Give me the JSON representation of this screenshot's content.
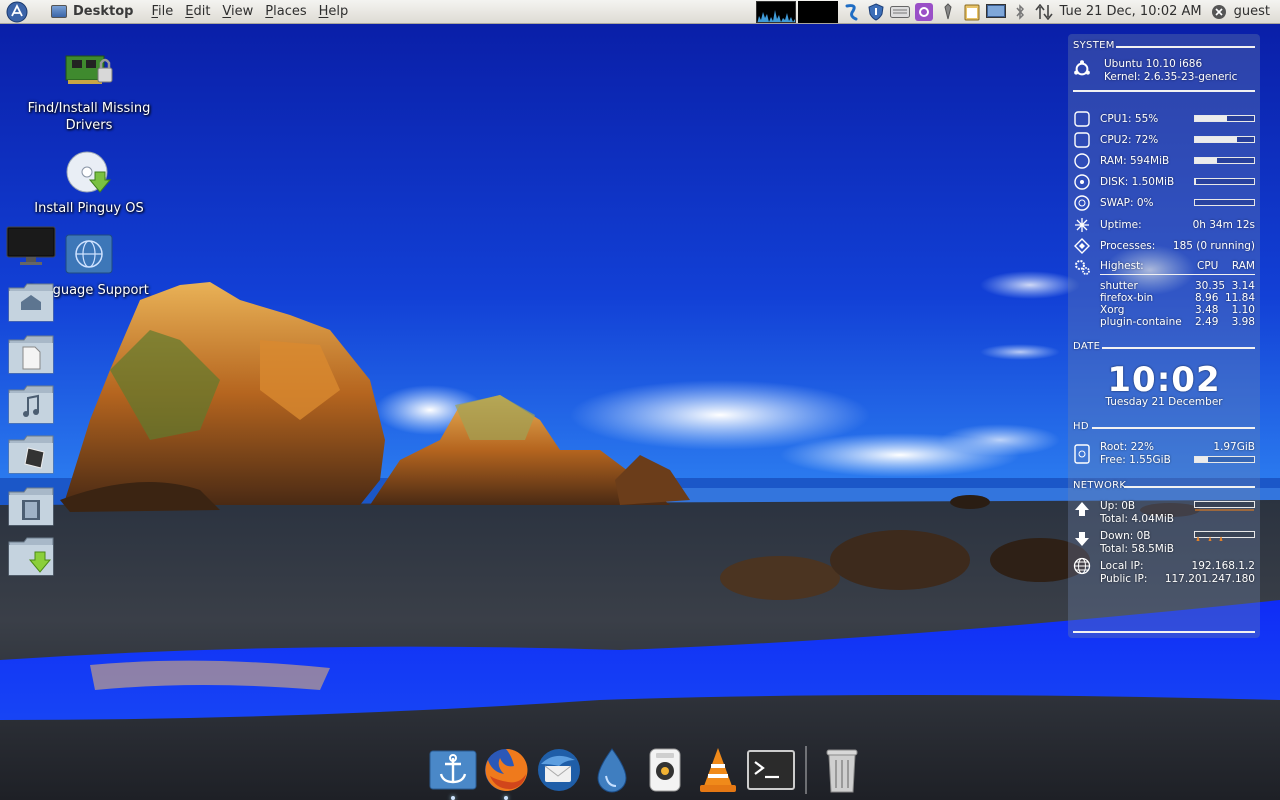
{
  "top_panel": {
    "window_title": "Desktop",
    "menus": [
      "File",
      "Edit",
      "View",
      "Places",
      "Help"
    ],
    "clock": "Tue 21 Dec, 10:02 AM",
    "user": "guest",
    "tray_icons": [
      "network-monitor-icon",
      "cpu-monitor-icon",
      "dropbox-icon",
      "shield-icon",
      "keyboard-icon",
      "settings-icon",
      "pen-icon",
      "clipboard-icon",
      "display-icon",
      "bluetooth-icon",
      "network-arrows-icon"
    ]
  },
  "desktop_icons": [
    {
      "label": "Find/Install Missing Drivers",
      "icon": "driver-card-icon"
    },
    {
      "label": "Install Pinguy OS",
      "icon": "install-disc-icon"
    },
    {
      "label": "Language Support",
      "icon": "language-globe-icon"
    }
  ],
  "left_dock": [
    "monitor-icon",
    "home-folder-icon",
    "documents-folder-icon",
    "music-folder-icon",
    "pictures-folder-icon",
    "videos-folder-icon",
    "downloads-folder-icon"
  ],
  "conky": {
    "system": {
      "heading": "SYSTEM",
      "os": "Ubuntu 10.10 i686",
      "kernel": "Kernel: 2.6.35-23-generic",
      "cpu1": "CPU1: 55%",
      "cpu1_level": 0.55,
      "cpu2": "CPU2: 72%",
      "cpu2_level": 0.72,
      "ram": "RAM: 594MiB",
      "ram_level": 0.38,
      "disk": "DISK: 1.50MiB",
      "disk_level": 0.02,
      "swap": "SWAP: 0%",
      "swap_level": 0,
      "uptime_label": "Uptime:",
      "uptime_value": "0h 34m 12s",
      "processes_label": "Processes:",
      "processes_value": "185 (0 running)",
      "highest_label": "Highest:",
      "col_cpu": "CPU",
      "col_ram": "RAM",
      "top_procs": [
        {
          "name": "shutter",
          "cpu": "30.35",
          "ram": "3.14"
        },
        {
          "name": "firefox-bin",
          "cpu": "8.96",
          "ram": "11.84"
        },
        {
          "name": "Xorg",
          "cpu": "3.48",
          "ram": "1.10"
        },
        {
          "name": "plugin-containe",
          "cpu": "2.49",
          "ram": "3.98"
        }
      ]
    },
    "date": {
      "heading": "DATE",
      "time": "10:02",
      "date": "Tuesday 21 December"
    },
    "hd": {
      "heading": "HD",
      "root": "Root: 22%",
      "root_size": "1.97GiB",
      "free": "Free: 1.55GiB",
      "root_level": 0.22
    },
    "network": {
      "heading": "NETWORK",
      "up": "Up: 0B",
      "up_total": "Total: 4.04MiB",
      "down": "Down: 0B",
      "down_total": "Total: 58.5MiB",
      "local_ip_label": "Local IP:",
      "local_ip": "192.168.1.2",
      "public_ip_label": "Public IP:",
      "public_ip": "117.201.247.180"
    }
  },
  "dock_items": [
    "docky-anchor-icon",
    "firefox-icon",
    "thunderbird-icon",
    "deluge-icon",
    "music-player-icon",
    "vlc-icon",
    "terminal-icon",
    "trash-icon"
  ]
}
